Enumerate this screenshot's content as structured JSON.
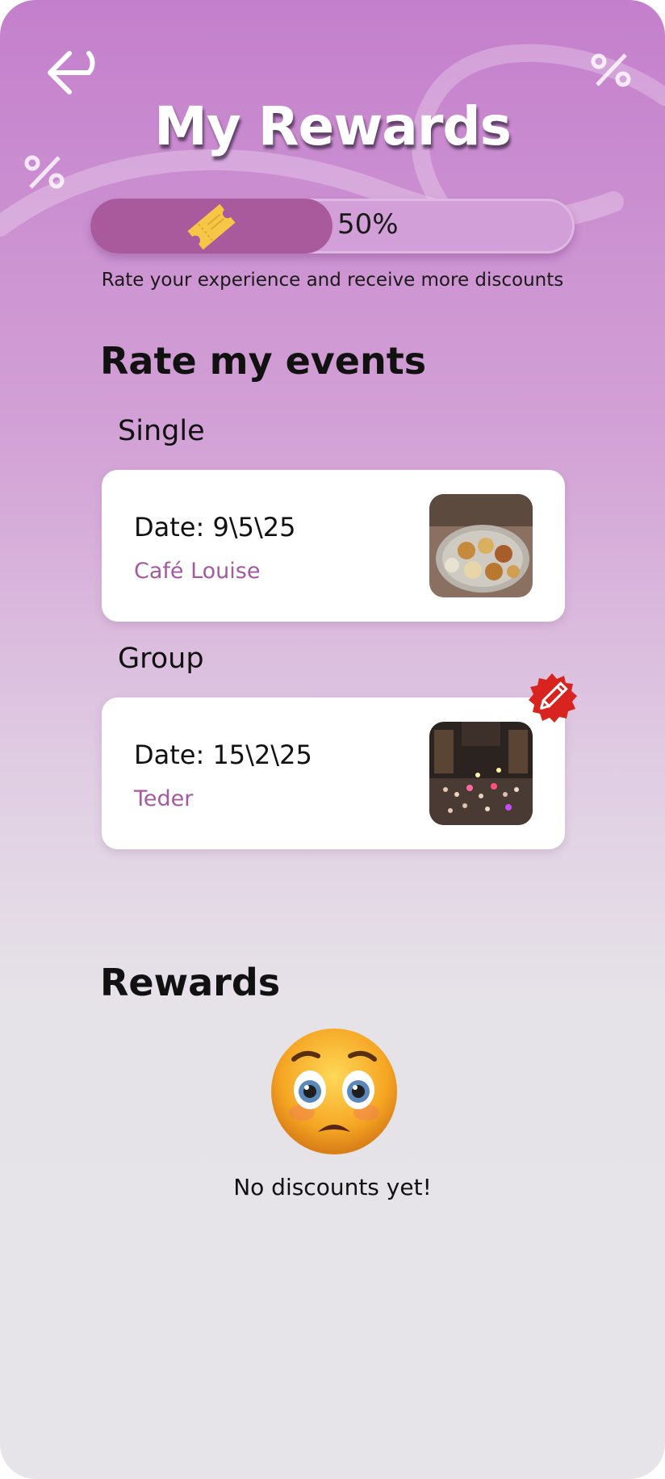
{
  "header": {
    "title": "My Rewards",
    "back_icon": "back-arrow-icon"
  },
  "progress": {
    "value_percent": 50,
    "label": "50%",
    "caption": "Rate your experience and receive more discounts",
    "icon": "ticket-icon"
  },
  "rate_events": {
    "title": "Rate my events",
    "single": {
      "label": "Single",
      "date": "Date: 9\\5\\25",
      "venue": "Café Louise"
    },
    "group": {
      "label": "Group",
      "date": "Date: 15\\2\\25",
      "venue": "Teder",
      "edit_icon": "edit-pencil-icon"
    }
  },
  "rewards": {
    "title": "Rewards",
    "empty_icon": "worried-face-icon",
    "empty_text": "No discounts yet!"
  },
  "colors": {
    "accent": "#a35a9f",
    "progress_fill": "#a95a9d",
    "badge": "#d8231f"
  }
}
